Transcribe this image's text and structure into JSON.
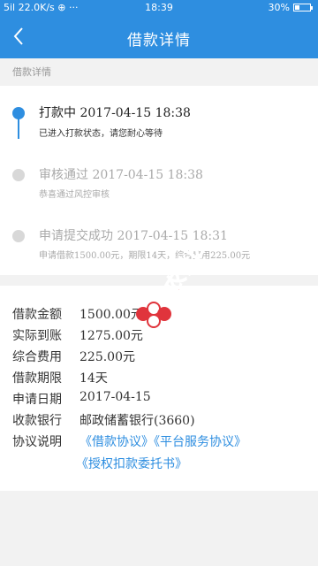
{
  "status_bar": {
    "left": "5il 22.0K/s ⊕ ···",
    "time": "18:39",
    "battery": "30%",
    "battery_level": 0.3
  },
  "header": {
    "title": "借款详情",
    "back_icon": "chevron-left-icon"
  },
  "section_label": "借款详情",
  "timeline": [
    {
      "title": "打款中 2017-04-15 18:38",
      "subtitle": "已进入打款状态，请您耐心等待",
      "state": "active"
    },
    {
      "title": "审核通过 2017-04-15 18:38",
      "subtitle": "恭喜通过风控审核",
      "state": "done"
    },
    {
      "title": "申请提交成功 2017-04-15 18:31",
      "subtitle": "申请借款1500.00元，期限14天，综合费用225.00元",
      "state": "done"
    }
  ],
  "details": [
    {
      "label": "借款金额",
      "value": "1500.00元"
    },
    {
      "label": "实际到账",
      "value": "1275.00元"
    },
    {
      "label": "综合费用",
      "value": "225.00元"
    },
    {
      "label": "借款期限",
      "value": "14天"
    },
    {
      "label": "申请日期",
      "value": "2017-04-15"
    },
    {
      "label": "收款银行",
      "value": "邮政储蓄银行(3660)"
    }
  ],
  "agreements": {
    "label": "协议说明",
    "links": [
      "《借款协议》",
      "《平台服务协议》",
      "《授权扣款委托书》"
    ]
  },
  "watermark": {
    "text": "卡农社区"
  },
  "colors": {
    "primary": "#2e8ee0",
    "watermark_red": "#e0343c"
  }
}
